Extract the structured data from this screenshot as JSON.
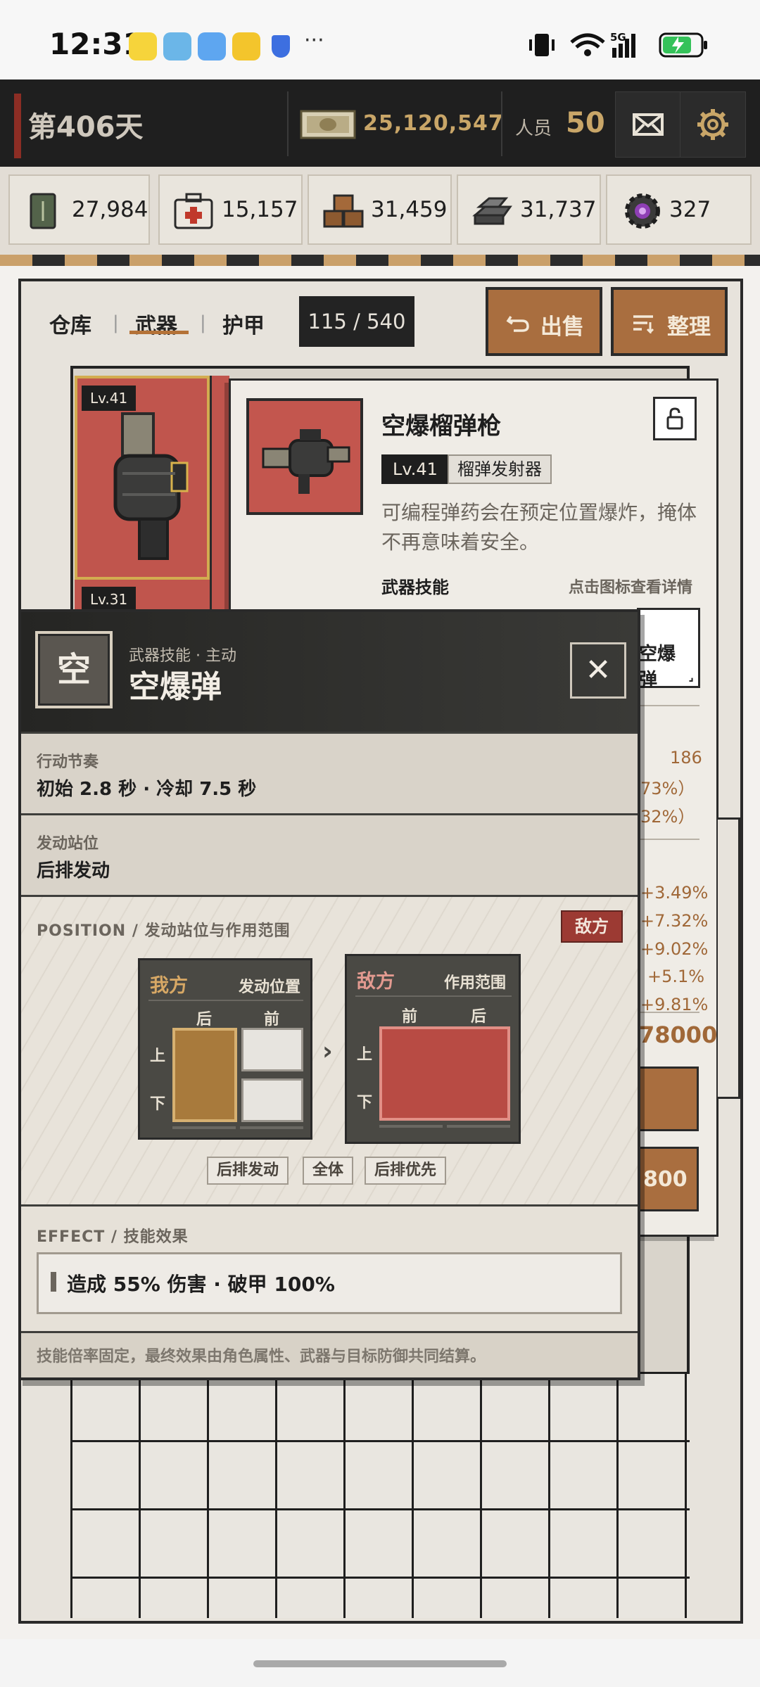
{
  "status_bar": {
    "time": "12:31",
    "app_icons": [
      "meituan-icon",
      "reader-icon",
      "weather-icon",
      "game-icon",
      "shield-icon"
    ],
    "more": "···",
    "network": "5G"
  },
  "header": {
    "day": "第406天",
    "money": "25,120,547",
    "staff_label": "人员",
    "staff_value": "50",
    "mail_icon": "mail-icon",
    "settings_icon": "gear-icon",
    "accent_color": "#c9a668"
  },
  "resources": [
    {
      "icon": "grain-can-icon",
      "value": "27,984"
    },
    {
      "icon": "medkit-icon",
      "value": "15,157"
    },
    {
      "icon": "wood-crates-icon",
      "value": "31,459"
    },
    {
      "icon": "metal-ingot-icon",
      "value": "31,737"
    },
    {
      "icon": "gear-core-icon",
      "value": "327"
    }
  ],
  "inventory": {
    "tabs": [
      "仓库",
      "武器",
      "护甲"
    ],
    "active_tab": "武器",
    "count": "115 / 540",
    "sell_button": "出售",
    "sort_button": "整理",
    "cards": [
      {
        "level": "Lv.41"
      },
      {
        "level": "Lv.31"
      }
    ]
  },
  "weapon_detail": {
    "name": "空爆榴弹枪",
    "level": "Lv.41",
    "type": "榴弹发射器",
    "description": "可编程弹药会在预定位置爆炸，掩体不再意味着安全。",
    "skill_section": "武器技能",
    "skill_hint": "点击图标查看详情",
    "skill_chip": "空爆弹",
    "stat_value": "186",
    "stat_partials": [
      "73%）",
      "32%）"
    ],
    "bonuses": [
      "+3.49%",
      "+7.32%",
      "+9.02%",
      "+5.1%",
      "+9.81%"
    ],
    "price_partial": "78000",
    "buy_partial": "800"
  },
  "skill_modal": {
    "icon_char": "空",
    "subtitle": "武器技能 · 主动",
    "title": "空爆弹",
    "close_icon": "close-icon",
    "timing_label": "行动节奏",
    "timing_value": "初始 2.8 秒 · 冷却 7.5 秒",
    "trigger_label": "发动站位",
    "trigger_value": "后排发动",
    "position_label": "POSITION / 发动站位与作用范围",
    "target_tag": "敌方",
    "ours": {
      "title": "我方",
      "note": "发动位置",
      "back": "后",
      "front": "前",
      "top": "上",
      "bottom": "下"
    },
    "enemy": {
      "title": "敌方",
      "note": "作用范围",
      "front": "前",
      "back": "后",
      "top": "上",
      "bottom": "下"
    },
    "arrow": "›",
    "chips": [
      "后排发动",
      "全体",
      "后排优先"
    ],
    "effect_label": "EFFECT / 技能效果",
    "effect_text": "造成 55% 伤害 · 破甲 100%",
    "footnote": "技能倍率固定，最终效果由角色属性、武器与目标防御共同结算。"
  }
}
